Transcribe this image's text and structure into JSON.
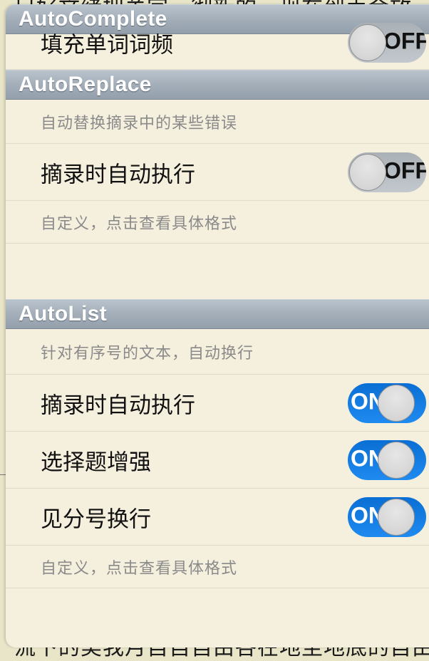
{
  "background": {
    "top_text": "只好文绪把关字一彻新的。现在到手会放",
    "bottom_text": "流下的美我月自自自由各在地至地底的自由"
  },
  "sections": {
    "autocomplete": {
      "title": "AutoComplete",
      "row_fill_label": "填充单词词频",
      "row_fill_toggle": "OFF"
    },
    "autoreplace": {
      "title": "AutoReplace",
      "note_top": "自动替换摘录中的某些错误",
      "row_exec_label": "摘录时自动执行",
      "row_exec_toggle": "OFF",
      "note_bottom": "自定义，点击查看具体格式"
    },
    "autolist": {
      "title": "AutoList",
      "note_top": "针对有序号的文本，自动换行",
      "rows": [
        {
          "label": "摘录时自动执行",
          "toggle": "ON",
          "state": true
        },
        {
          "label": "选择题增强",
          "toggle": "ON",
          "state": true
        },
        {
          "label": "见分号换行",
          "toggle": "ON",
          "state": true
        }
      ],
      "note_bottom": "自定义，点击查看具体格式"
    }
  },
  "colors": {
    "panel_bg": "#f5efdd",
    "header_bg": "#a3aeb9",
    "toggle_on": "#1f8af0",
    "toggle_off": "#b5bcc2"
  }
}
